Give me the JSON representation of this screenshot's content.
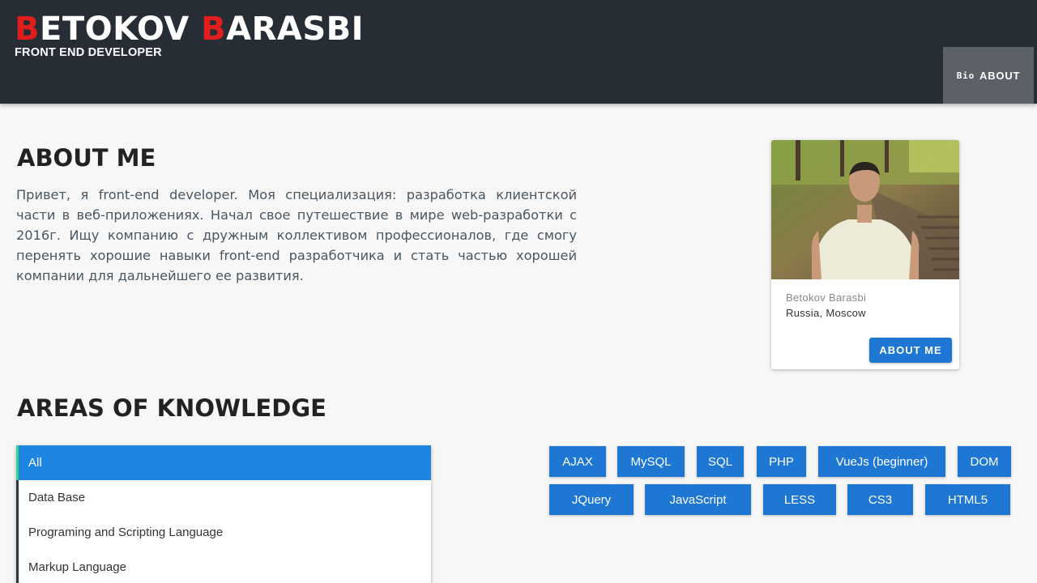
{
  "header": {
    "brand_first_initial": "B",
    "brand_first_rest": "ETOKOV ",
    "brand_last_initial": "B",
    "brand_last_rest": "ARASBI",
    "subtitle": "FRONT END DEVELOPER",
    "nav": {
      "bio_label": "Bio",
      "about_label": "ABOUT"
    }
  },
  "about": {
    "heading": "ABOUT ME",
    "text": "Привет, я front-end developer. Моя специализация: разработка клиентской части в веб-приложениях. Начал свое путешествие в мире web-разработки с 2016г. Ищу компанию с дружным коллективом профессионалов, где смогу перенять хорошие навыки front-end разработчика и стать частью хорошей компании для дальнейшего ее развития."
  },
  "card": {
    "name": "Betokov Barasbi",
    "location": "Russia, Moscow",
    "button": "ABOUT ME"
  },
  "areas": {
    "heading": "AREAS OF KNOWLEDGE",
    "filters": [
      {
        "label": "All",
        "active": true
      },
      {
        "label": "Data Base",
        "active": false
      },
      {
        "label": "Programing and Scripting Language",
        "active": false
      },
      {
        "label": "Markup Language",
        "active": false
      }
    ],
    "tags": [
      "AJAX",
      "MySQL",
      "SQL",
      "PHP",
      "VueJs (beginner)",
      "DOM",
      "JQuery",
      "JavaScript",
      "LESS",
      "CS3",
      "HTML5"
    ]
  },
  "colors": {
    "header_bg": "#262d34",
    "accent_red": "#e01e1e",
    "primary_blue": "#1e77d2",
    "active_item": "#1e86e0",
    "active_marker": "#3bcf8e"
  }
}
